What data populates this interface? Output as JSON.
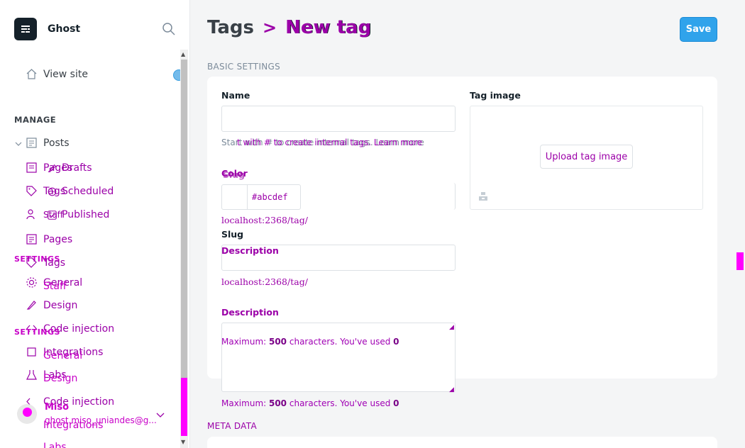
{
  "brand": {
    "name": "Ghost",
    "logo_icon": "ghost-logo-icon"
  },
  "sidebar": {
    "view_site": "View site",
    "manage_heading": "MANAGE",
    "posts": "Posts",
    "drafts": "Drafts",
    "scheduled": "Scheduled",
    "published": "Published",
    "pages": "Pages",
    "tags": "Tags",
    "staff": "Staff",
    "settings_heading": "SETTINGS",
    "general": "General",
    "design": "Design",
    "code_injection": "Code injection",
    "integrations": "Integrations",
    "labs": "Labs",
    "ghost_pages": "Pages",
    "ghost_tags": "Tags",
    "ghost_staff": "Staff",
    "ghost_settings": "SETTINGS",
    "ghost_general": "General",
    "ghost_design": "Design",
    "ghost_code_injection": "Code injection",
    "ghost_integrations": "Integrations",
    "ghost_labs": "Labs",
    "user_name": "Miso",
    "user_email": "ghost.miso_uniandes@g..."
  },
  "header": {
    "breadcrumb_parent": "Tags",
    "breadcrumb_sep": ">",
    "breadcrumb_current": "New tag",
    "save_label": "Save"
  },
  "basic_settings": {
    "title": "BASIC SETTINGS",
    "name_label": "Name",
    "name_value": "",
    "name_hint": "Start with # to create internal tags. Learn more",
    "name_hint_overlay": "t with #  to create internal tags. Learn more",
    "color_label": "Color",
    "color_label_ghost": "Slug",
    "color_hex": "#abcdef",
    "slug_prefix_1": "localhost:2368/tag/",
    "slug_label": "Slug",
    "description_label_ghost": "Description",
    "slug_prefix_2": "localhost:2368/tag/",
    "description_label": "Description",
    "description_hint_prefix": "Maximum: ",
    "description_max": "500",
    "description_hint_mid": " characters. You've used ",
    "description_used": "0",
    "tag_image_label": "Tag image",
    "upload_label": "Upload tag image"
  },
  "meta_data": {
    "title": "META DATA"
  },
  "colors": {
    "accent": "#30a3eb",
    "overlay": "#ff00ff",
    "overlay_text": "#9b00a8"
  }
}
